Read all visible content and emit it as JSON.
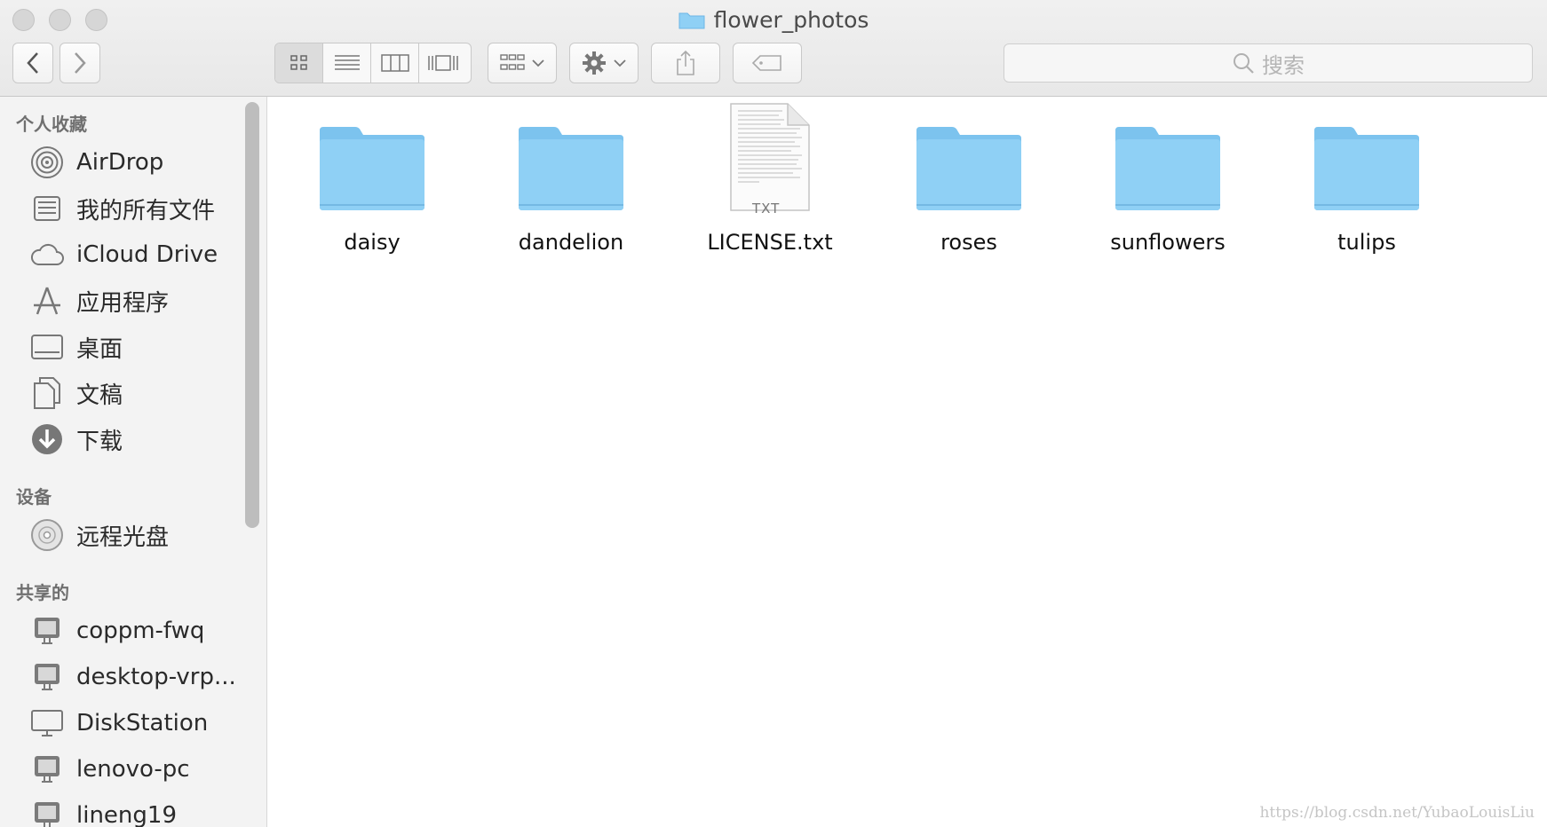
{
  "window": {
    "title": "flower_photos"
  },
  "toolbar": {
    "back_icon": "chevron-left-icon",
    "forward_icon": "chevron-right-icon",
    "view_modes": [
      "icon-view",
      "list-view",
      "column-view",
      "cover-flow-view"
    ],
    "active_view": "icon-view",
    "search_placeholder": "搜索"
  },
  "sidebar": {
    "sections": [
      {
        "title": "个人收藏",
        "items": [
          {
            "label": "AirDrop",
            "icon": "airdrop-icon"
          },
          {
            "label": "我的所有文件",
            "icon": "all-files-icon"
          },
          {
            "label": "iCloud Drive",
            "icon": "cloud-icon"
          },
          {
            "label": "应用程序",
            "icon": "applications-icon"
          },
          {
            "label": "桌面",
            "icon": "desktop-icon"
          },
          {
            "label": "文稿",
            "icon": "documents-icon"
          },
          {
            "label": "下载",
            "icon": "download-icon"
          }
        ]
      },
      {
        "title": "设备",
        "items": [
          {
            "label": "远程光盘",
            "icon": "disc-icon"
          }
        ]
      },
      {
        "title": "共享的",
        "items": [
          {
            "label": "coppm-fwq",
            "icon": "computer-icon"
          },
          {
            "label": "desktop-vrp...",
            "icon": "computer-icon"
          },
          {
            "label": "DiskStation",
            "icon": "display-icon"
          },
          {
            "label": "lenovo-pc",
            "icon": "computer-icon"
          },
          {
            "label": "lineng19",
            "icon": "computer-icon"
          }
        ]
      }
    ]
  },
  "files": [
    {
      "name": "daisy",
      "type": "folder"
    },
    {
      "name": "dandelion",
      "type": "folder"
    },
    {
      "name": "LICENSE.txt",
      "type": "txt",
      "badge": "TXT"
    },
    {
      "name": "roses",
      "type": "folder"
    },
    {
      "name": "sunflowers",
      "type": "folder"
    },
    {
      "name": "tulips",
      "type": "folder"
    }
  ],
  "watermark": "https://blog.csdn.net/YubaoLouisLiu",
  "colors": {
    "folder_blue": "#8fd0f5",
    "folder_tab": "#7cc3ee"
  }
}
